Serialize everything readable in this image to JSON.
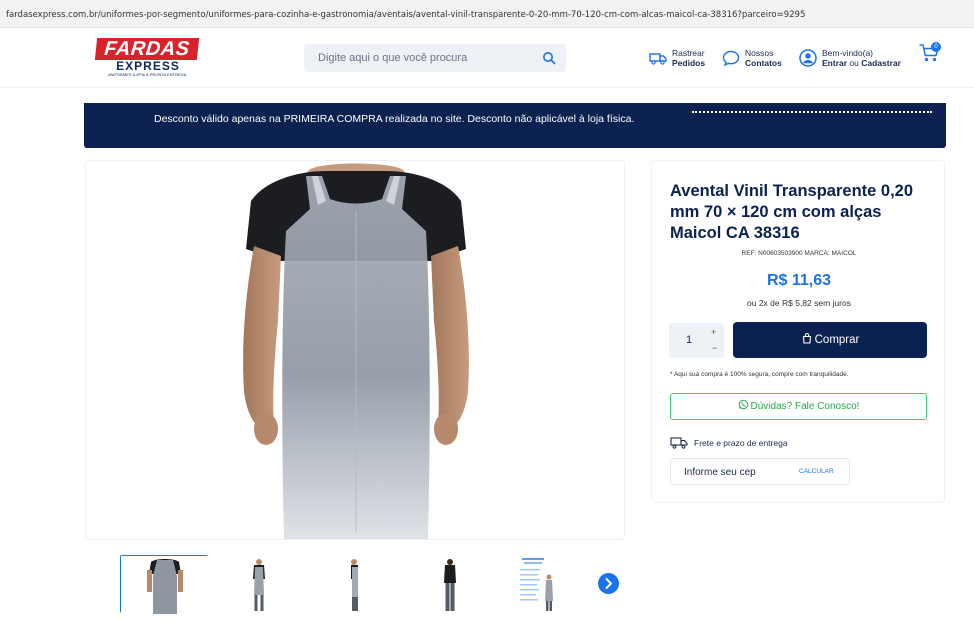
{
  "browser": {
    "url": "fardasexpress.com.br/uniformes-por-segmento/uniformes-para-cozinha-e-gastronomia/aventais/avental-vinil-transparente-0-20-mm-70-120-cm-com-alcas-maicol-ca-38316?parceiro=9295"
  },
  "header": {
    "logo_top": "FARDAS",
    "logo_mid": "EXPRESS",
    "logo_tagline": "UNIFORMES & EPIs À PRONTA ENTREGA",
    "search_placeholder": "Digite aqui o que você procura",
    "track_line1": "Rastrear",
    "track_line2": "Pedidos",
    "contact_line1": "Nossos",
    "contact_line2": "Contatos",
    "account_line1": "Bem-vindo(a)",
    "account_enter": "Entrar",
    "account_or": " ou ",
    "account_register": "Cadastrar",
    "cart_count": "0"
  },
  "banner": {
    "text": "Desconto válido apenas na PRIMEIRA COMPRA realizada no site. Desconto não aplicável à loja física."
  },
  "product": {
    "title": "Avental Vinil Transparente 0,20 mm 70 × 120 cm com alças Maicol CA 38316",
    "ref": "REF:  N00603503900    MARCA: MAICOL",
    "price": "R$ 11,63",
    "installments": "ou 2x de R$ 5,82 sem juros",
    "quantity": "1",
    "qty_plus": "+",
    "qty_minus": "−",
    "buy_label": "Comprar",
    "secure_note": "* Aqui sua compra é 100% segura, compre com tranquilidade.",
    "whatsapp_label": "Dúvidas? Fale Conosco!",
    "shipping_label": "Frete e prazo de entrega",
    "cep_placeholder": "Informe seu cep",
    "calc_label": "CALCULAR"
  },
  "colors": {
    "navy": "#0b2250",
    "blue": "#1a73e8",
    "red": "#d8232a",
    "green": "#2aa84f"
  }
}
